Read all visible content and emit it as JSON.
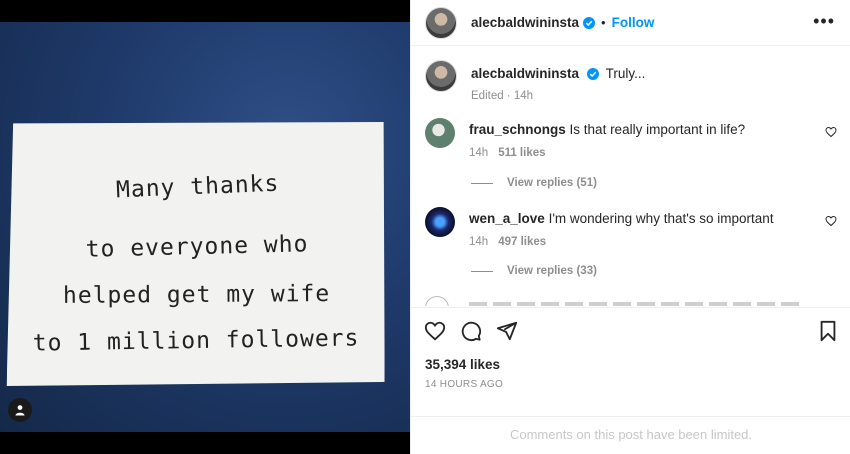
{
  "post": {
    "username": "alecbaldwininsta",
    "follow_label": "Follow",
    "more_label": "•••",
    "caption_text": "Truly...",
    "caption_meta": "Edited · 14h",
    "note_lines": [
      "Many thanks",
      "to everyone who",
      "helped get my wife",
      "to 1 million followers"
    ]
  },
  "comments": [
    {
      "username": "frau_schnongs",
      "text": "Is that really important in life?",
      "time": "14h",
      "likes": "511 likes",
      "replies": "View replies (51)",
      "avatar_color": "#5f7f6f"
    },
    {
      "username": "wen_a_love",
      "text": "I'm wondering why that's so important",
      "time": "14h",
      "likes": "497 likes",
      "replies": "View replies (33)",
      "avatar_color": "#1a2a6b"
    }
  ],
  "actions": {
    "likes": "35,394 likes",
    "timestamp": "14 HOURS AGO",
    "limited_notice": "Comments on this post have been limited."
  },
  "colors": {
    "link": "#0095f6",
    "muted": "#8e8e8e",
    "verified": "#0095f6"
  },
  "icons": [
    "verified-badge-icon",
    "heart-icon",
    "comment-icon",
    "share-icon",
    "bookmark-icon",
    "user-tag-icon",
    "more-icon"
  ]
}
